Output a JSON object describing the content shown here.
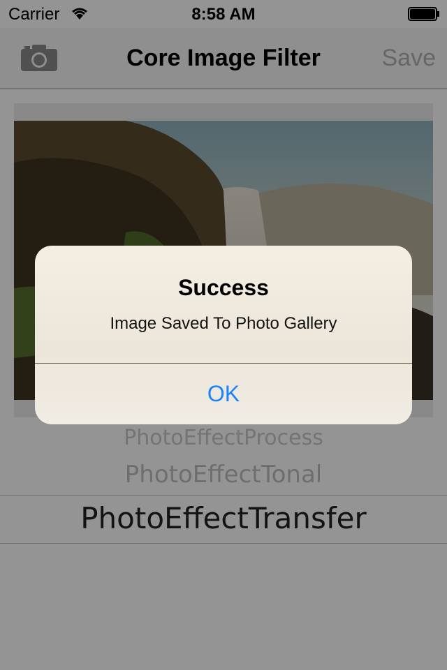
{
  "status_bar": {
    "carrier": "Carrier",
    "time": "8:58 AM"
  },
  "nav_bar": {
    "camera_icon": "camera-icon",
    "title": "Core Image Filter",
    "save_label": "Save"
  },
  "picker": {
    "items": [
      "PhotoEffectProcess",
      "PhotoEffectTonal",
      "PhotoEffectTransfer"
    ],
    "selected": "PhotoEffectTransfer"
  },
  "alert": {
    "title": "Success",
    "message": "Image Saved To Photo Gallery",
    "ok_label": "OK"
  },
  "colors": {
    "accent": "#1a82fb",
    "dim_overlay": "#000000"
  }
}
